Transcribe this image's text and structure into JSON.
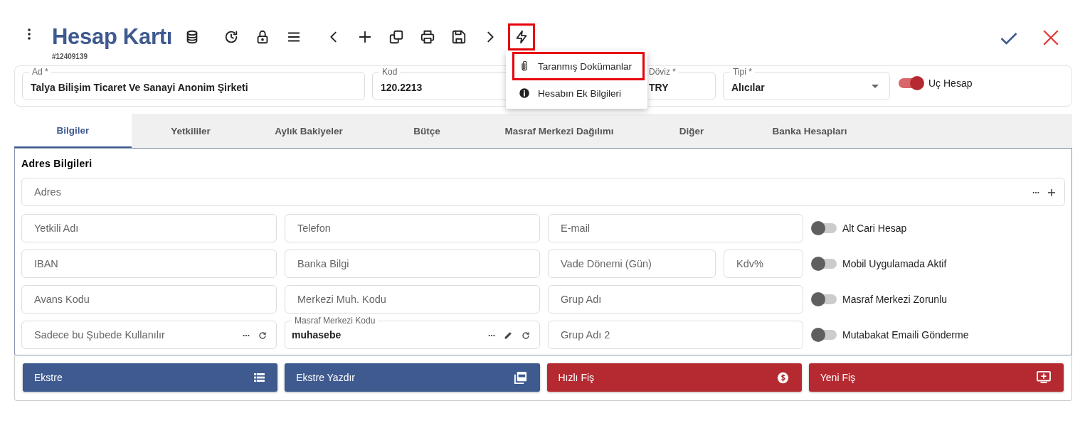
{
  "header": {
    "title": "Hesap Kartı",
    "record_no": "#12409139"
  },
  "toolbar": [
    {
      "kind": "database",
      "highlighted": false
    },
    {
      "kind": "history",
      "highlighted": false
    },
    {
      "kind": "lock",
      "highlighted": false
    },
    {
      "kind": "menu",
      "highlighted": false
    },
    {
      "kind": "prev",
      "highlighted": false
    },
    {
      "kind": "add",
      "highlighted": false
    },
    {
      "kind": "copy",
      "highlighted": false
    },
    {
      "kind": "print",
      "highlighted": false
    },
    {
      "kind": "save",
      "highlighted": false
    },
    {
      "kind": "next",
      "highlighted": false
    },
    {
      "kind": "bolt",
      "highlighted": true
    }
  ],
  "menu": [
    {
      "kind": "attach",
      "label": "Taranmış Dokümanlar",
      "highlighted": true
    },
    {
      "kind": "info",
      "label": "Hesabın Ek Bilgileri",
      "highlighted": false
    }
  ],
  "main_fields": [
    {
      "label": "Ad *",
      "value": "Talya Bilişim Ticaret Ve Sanayi Anonim Şirketi"
    },
    {
      "label": "Kod",
      "value": "120.2213"
    },
    {
      "label": "Döviz *",
      "value": "TRY"
    },
    {
      "label": "Tipi *",
      "value": "Alıcılar",
      "kind": "select"
    }
  ],
  "main_toggle": {
    "label": "Uç Hesap",
    "on": true
  },
  "tabs": [
    {
      "label": "Bilgiler",
      "selected": true
    },
    {
      "label": "Yetkililer",
      "selected": false
    },
    {
      "label": "Aylık Bakiyeler",
      "selected": false
    },
    {
      "label": "Bütçe",
      "selected": false
    },
    {
      "label": "Masraf Merkezi Dağılımı",
      "selected": false
    },
    {
      "label": "Diğer",
      "selected": false
    },
    {
      "label": "Banka Hesapları",
      "selected": false
    }
  ],
  "section_title": "Adres Bilgileri",
  "address": {
    "placeholder": "Adres"
  },
  "rows": [
    {
      "fields": [
        {
          "placeholder": "Yetkili Adı"
        },
        {
          "placeholder": "Telefon"
        },
        {
          "placeholder": "E-mail"
        }
      ],
      "toggle": {
        "label": "Alt Cari Hesap",
        "on": false
      }
    },
    {
      "fields": [
        {
          "placeholder": "IBAN"
        },
        {
          "placeholder": "Banka Bilgi"
        },
        {
          "placeholder": "Vade Dönemi (Gün)",
          "kind": "split"
        },
        {
          "placeholder": "Kdv%",
          "kind": "split"
        }
      ],
      "toggle": {
        "label": "Mobil Uygulamada Aktif",
        "on": false
      }
    },
    {
      "fields": [
        {
          "placeholder": "Avans Kodu"
        },
        {
          "placeholder": "Merkezi Muh. Kodu"
        },
        {
          "placeholder": "Grup Adı"
        }
      ],
      "toggle": {
        "label": "Masraf Merkezi Zorunlu",
        "on": false
      }
    },
    {
      "fields": [
        {
          "placeholder": "Sadece bu Şubede Kullanılır",
          "kind": "lookup"
        },
        {
          "label": "Masraf Merkezi Kodu",
          "value": "muhasebe",
          "kind": "lookup-edit"
        },
        {
          "placeholder": "Grup Adı 2"
        }
      ],
      "toggle": {
        "label": "Mutabakat Emaili Gönderme",
        "on": false
      }
    }
  ],
  "buttons": [
    {
      "label": "Ekstre",
      "kind": "list",
      "color": "#3e5a8f"
    },
    {
      "label": "Ekstre Yazdır",
      "kind": "pdf",
      "color": "#3e5a8f"
    },
    {
      "label": "Hızlı Fiş",
      "kind": "dollar",
      "color": "#b52a31"
    },
    {
      "label": "Yeni Fiş",
      "kind": "new",
      "color": "#b52a31"
    }
  ]
}
